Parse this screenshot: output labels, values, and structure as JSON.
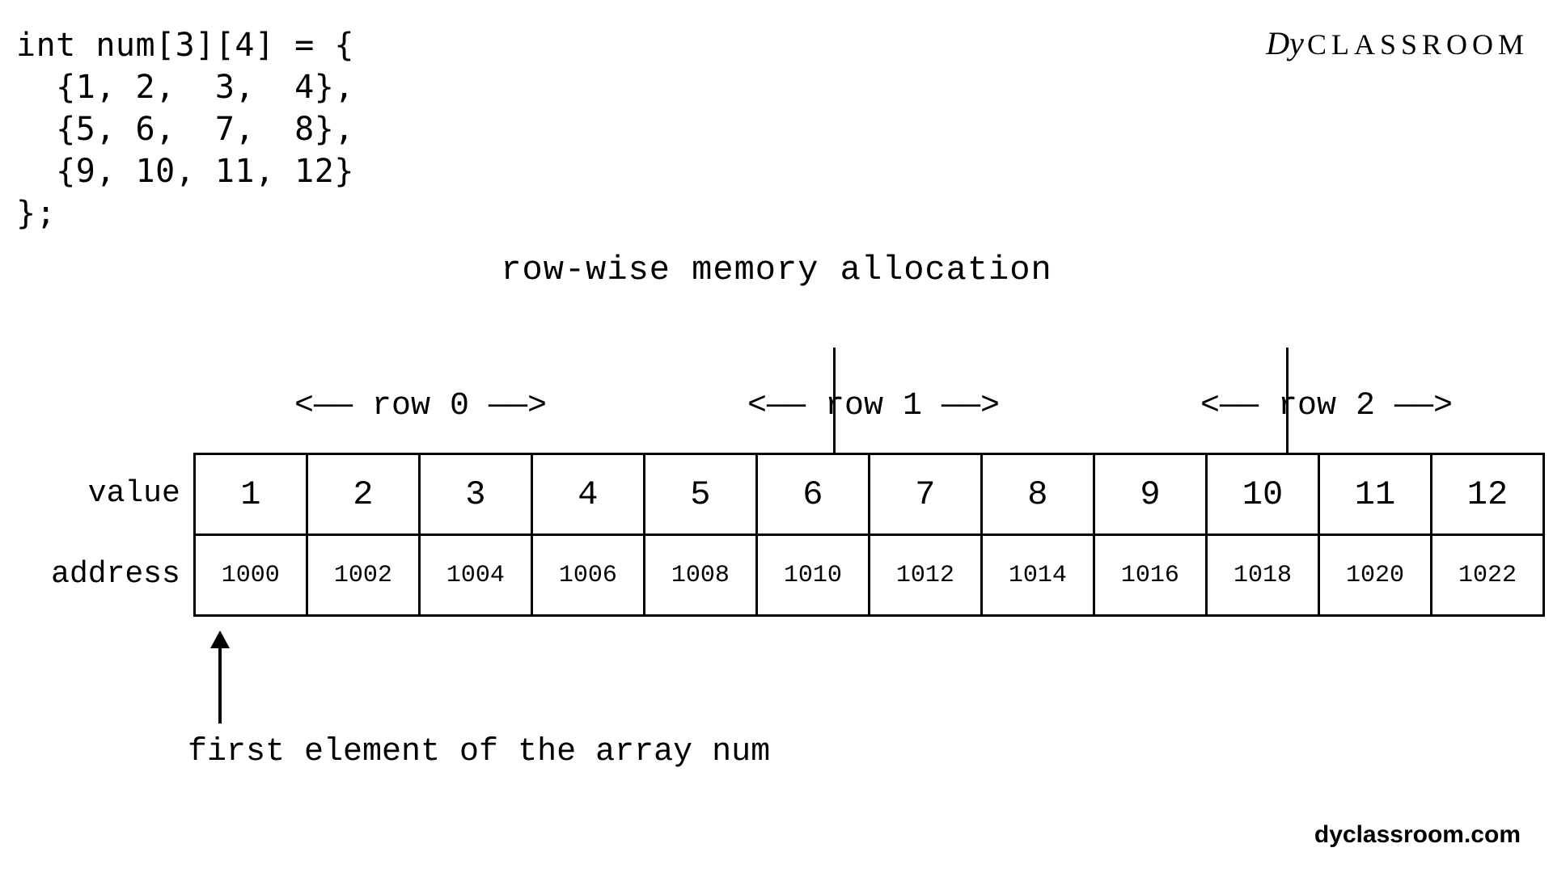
{
  "code": "int num[3][4] = {\n  {1, 2,  3,  4},\n  {5, 6,  7,  8},\n  {9, 10, 11, 12}\n};",
  "logo_dy": "Dy",
  "logo_rest": "CLASSROOM",
  "title": "row-wise memory allocation",
  "row_headers": {
    "r0": "<——  row 0  ——>",
    "r1": "<——  row 1  ——>",
    "r2": "<——  row 2  ——>"
  },
  "labels": {
    "value": "value",
    "address": "address"
  },
  "chart_data": {
    "type": "table",
    "title": "row-wise memory allocation",
    "columns": 12,
    "row_groups": [
      "row 0",
      "row 0",
      "row 0",
      "row 0",
      "row 1",
      "row 1",
      "row 1",
      "row 1",
      "row 2",
      "row 2",
      "row 2",
      "row 2"
    ],
    "values": [
      "1",
      "2",
      "3",
      "4",
      "5",
      "6",
      "7",
      "8",
      "9",
      "10",
      "11",
      "12"
    ],
    "addresses": [
      "1000",
      "1002",
      "1004",
      "1006",
      "1008",
      "1010",
      "1012",
      "1014",
      "1016",
      "1018",
      "1020",
      "1022"
    ]
  },
  "caption": "first element of the array num",
  "footer": "dyclassroom.com"
}
